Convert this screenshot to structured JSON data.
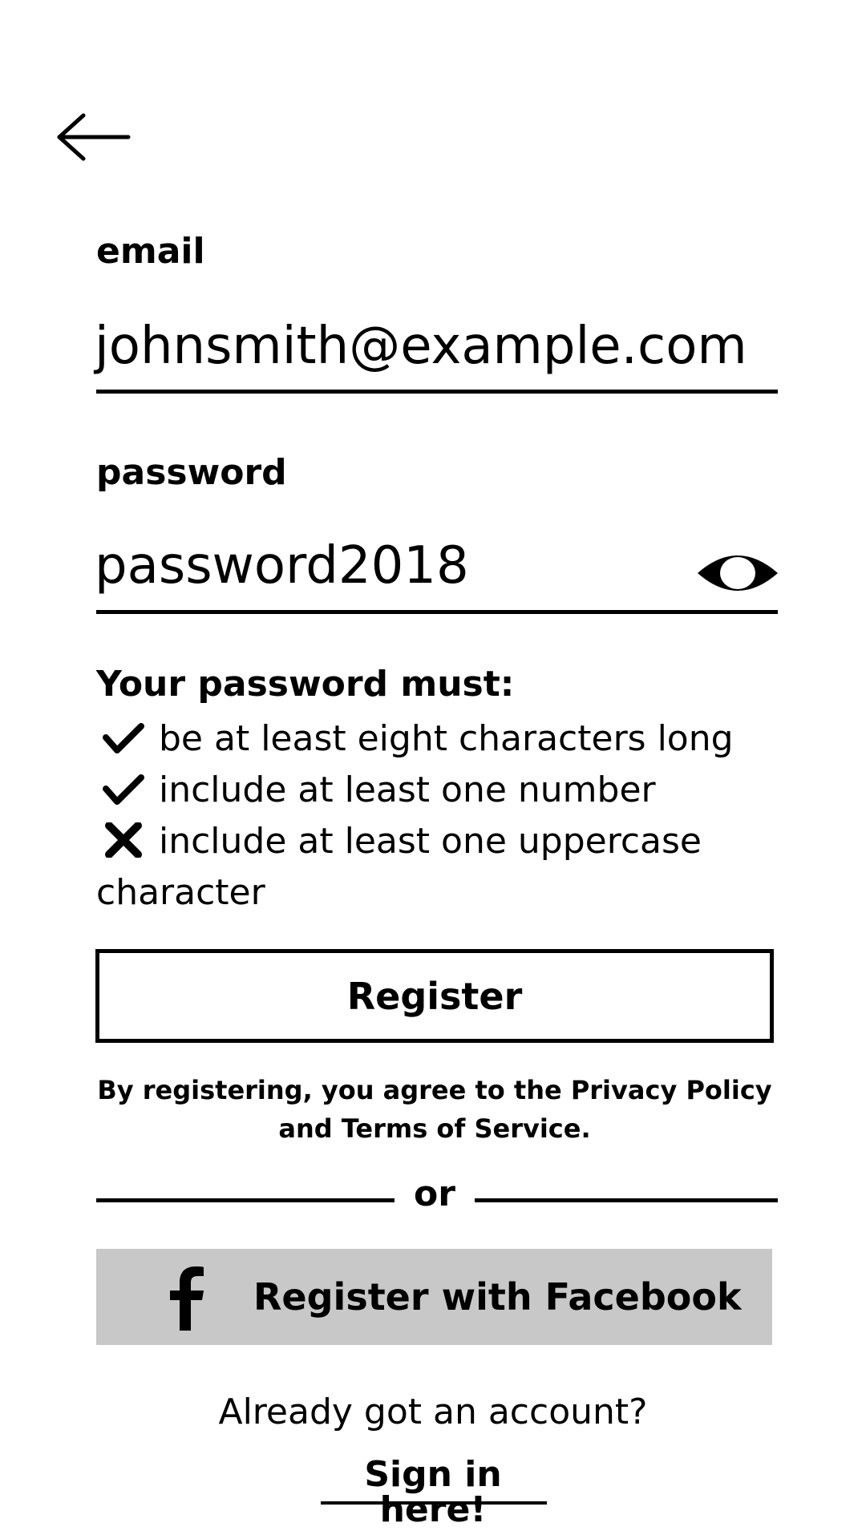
{
  "back": {
    "icon": "arrow-left-icon"
  },
  "email": {
    "label": "email",
    "value": "johnsmith@example.com"
  },
  "password": {
    "label": "password",
    "value": "password2018",
    "toggle_icon": "eye-icon"
  },
  "rules": {
    "title": "Your password must:",
    "items": [
      {
        "text": "be at least eight characters long",
        "status": "met",
        "icon": "check-icon"
      },
      {
        "text": "include at least one number",
        "status": "met",
        "icon": "check-icon"
      },
      {
        "text": "include at least one uppercase character",
        "status": "unmet",
        "icon": "cross-icon"
      }
    ]
  },
  "register": {
    "label": "Register"
  },
  "terms": {
    "text": "By registering, you agree to the Privacy Policy and Terms of Service."
  },
  "divider": {
    "text": "or"
  },
  "facebook": {
    "label": "Register with Facebook",
    "icon": "facebook-icon",
    "background": "#c8c8c8"
  },
  "signin": {
    "prompt": "Already got an account?",
    "link": "Sign in here!"
  }
}
